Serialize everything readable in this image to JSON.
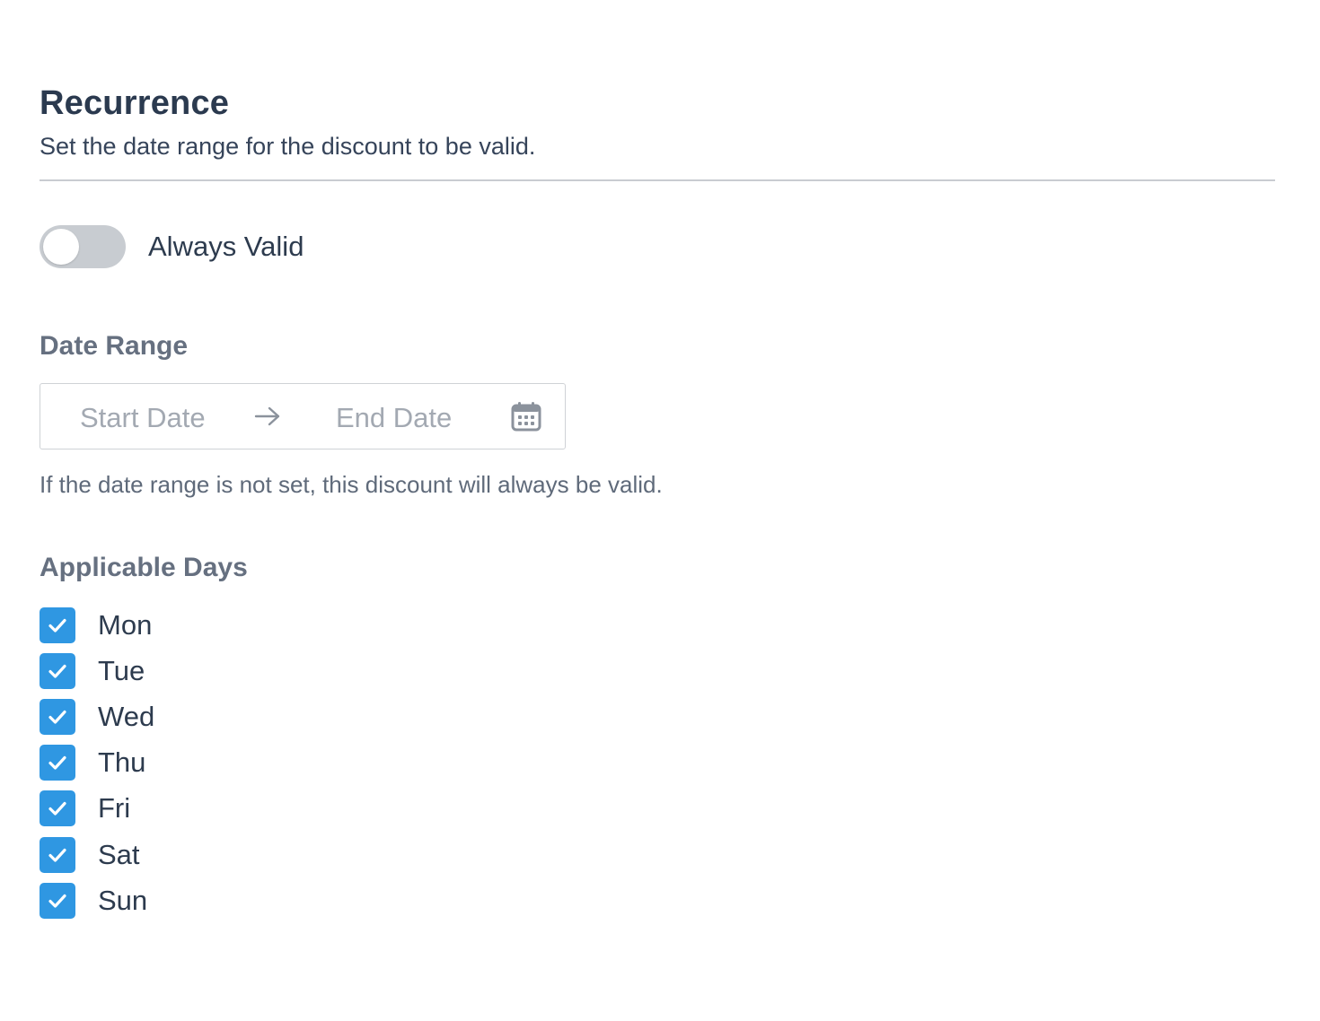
{
  "section": {
    "title": "Recurrence",
    "description": "Set the date range for the discount to be valid."
  },
  "always_valid": {
    "label": "Always Valid",
    "enabled": false
  },
  "date_range": {
    "label": "Date Range",
    "start_placeholder": "Start Date",
    "end_placeholder": "End Date",
    "start_value": "",
    "end_value": "",
    "separator_icon": "arrow-right-icon",
    "calendar_icon": "calendar-icon",
    "helper": "If the date range is not set, this discount will always be valid."
  },
  "applicable_days": {
    "label": "Applicable Days",
    "days": [
      {
        "label": "Mon",
        "checked": true
      },
      {
        "label": "Tue",
        "checked": true
      },
      {
        "label": "Wed",
        "checked": true
      },
      {
        "label": "Thu",
        "checked": true
      },
      {
        "label": "Fri",
        "checked": true
      },
      {
        "label": "Sat",
        "checked": true
      },
      {
        "label": "Sun",
        "checked": true
      }
    ]
  },
  "colors": {
    "checkbox": "#2f97e2",
    "toggle_off": "#c8ccd1",
    "title": "#2b3a4f",
    "label": "#667080",
    "placeholder": "#a3a9b2"
  }
}
